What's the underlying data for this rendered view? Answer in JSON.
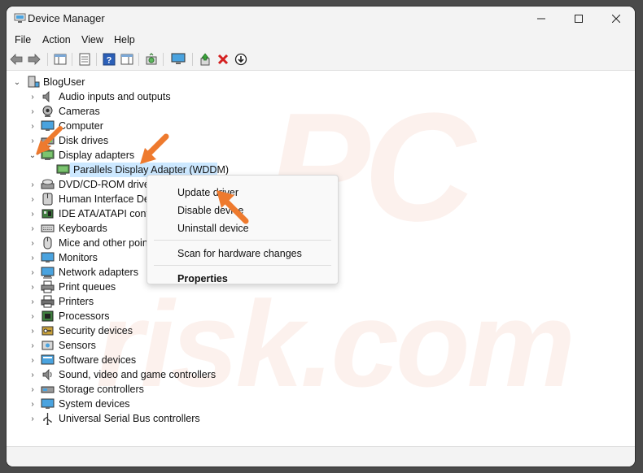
{
  "window": {
    "title": "Device Manager"
  },
  "menu": [
    "File",
    "Action",
    "View",
    "Help"
  ],
  "tree": {
    "root": "BlogUser",
    "items": [
      "Audio inputs and outputs",
      "Cameras",
      "Computer",
      "Disk drives",
      "Display adapters",
      "Parallels Display Adapter (WDDM)",
      "DVD/CD-ROM drives",
      "Human Interface Dev",
      "IDE ATA/ATAPI control",
      "Keyboards",
      "Mice and other point",
      "Monitors",
      "Network adapters",
      "Print queues",
      "Printers",
      "Processors",
      "Security devices",
      "Sensors",
      "Software devices",
      "Sound, video and game controllers",
      "Storage controllers",
      "System devices",
      "Universal Serial Bus controllers"
    ]
  },
  "context_menu": {
    "update": "Update driver",
    "disable": "Disable device",
    "uninstall": "Uninstall device",
    "scan": "Scan for hardware changes",
    "properties": "Properties"
  },
  "colors": {
    "accent": "#ee7a2e",
    "selection": "#cce8ff"
  }
}
